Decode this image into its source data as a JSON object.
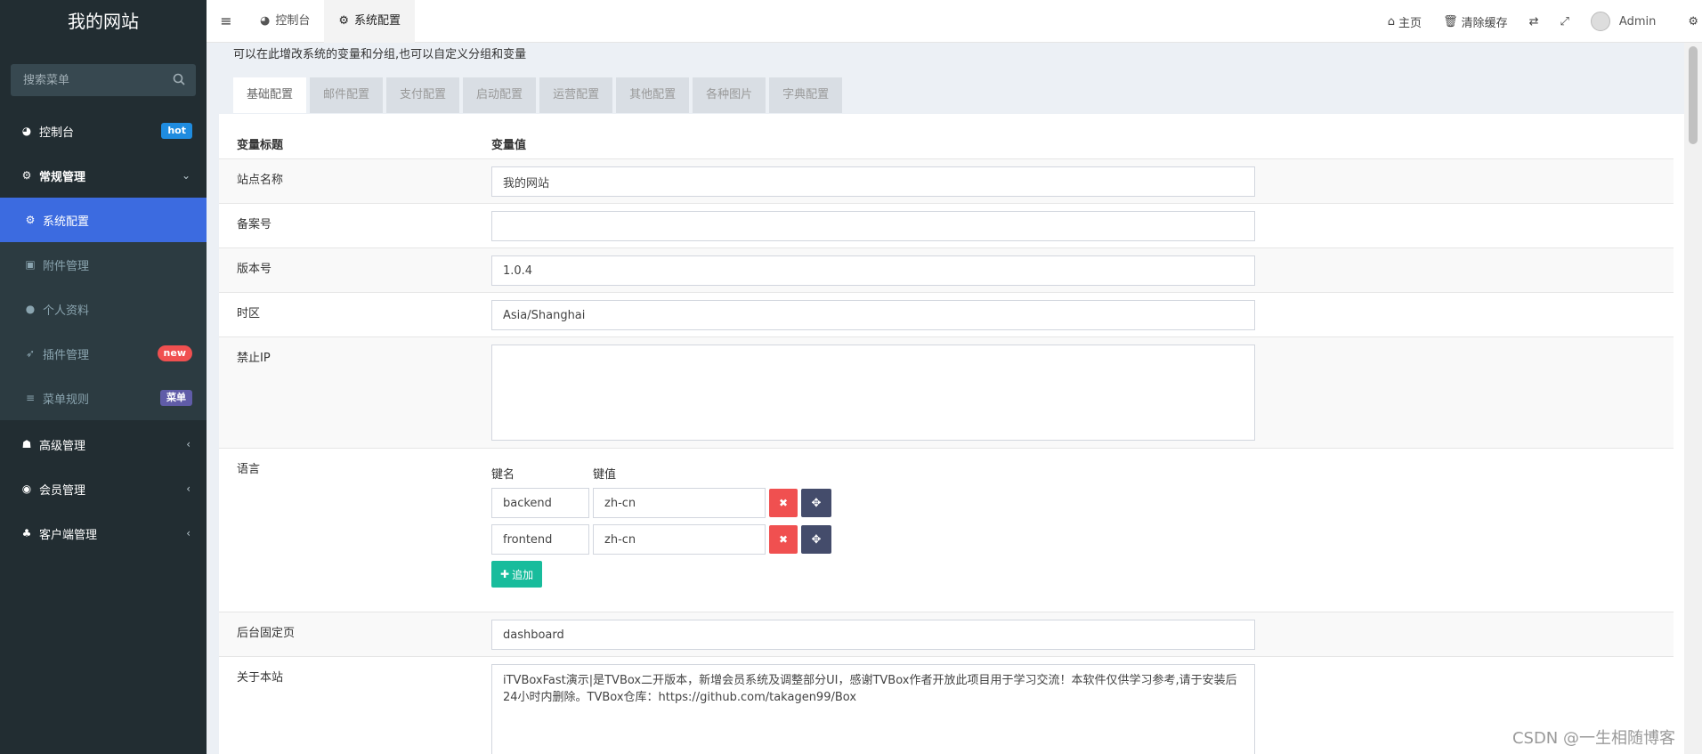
{
  "sidebar": {
    "logo": "我的网站",
    "search_placeholder": "搜索菜单",
    "items": [
      {
        "label": "控制台",
        "badge": "hot",
        "icon": "dashboard-icon"
      },
      {
        "label": "常规管理",
        "icon": "cogs-icon"
      },
      {
        "label": "系统配置",
        "icon": "gear-icon"
      },
      {
        "label": "附件管理",
        "icon": "image-icon"
      },
      {
        "label": "个人资料",
        "icon": "user-icon"
      },
      {
        "label": "插件管理",
        "badge": "new",
        "icon": "rocket-icon"
      },
      {
        "label": "菜单规则",
        "badge": "菜单",
        "icon": "list-icon"
      },
      {
        "label": "高级管理",
        "icon": "users-icon"
      },
      {
        "label": "会员管理",
        "icon": "user-circle-icon"
      },
      {
        "label": "客户端管理",
        "icon": "android-icon"
      }
    ]
  },
  "topbar": {
    "tabs": [
      {
        "label": "控制台",
        "icon": "dashboard-icon"
      },
      {
        "label": "系统配置",
        "icon": "gear-icon"
      }
    ],
    "right": {
      "home": "主页",
      "clear_cache": "清除缓存",
      "user": "Admin"
    }
  },
  "main": {
    "description": "可以在此增改系统的变量和分组,也可以自定义分组和变量",
    "config_tabs": [
      "基础配置",
      "邮件配置",
      "支付配置",
      "启动配置",
      "运营配置",
      "其他配置",
      "各种图片",
      "字典配置"
    ],
    "table_headers": {
      "title": "变量标题",
      "value": "变量值"
    },
    "fields": {
      "site_name": {
        "label": "站点名称",
        "value": "我的网站"
      },
      "beian": {
        "label": "备案号",
        "value": ""
      },
      "version": {
        "label": "版本号",
        "value": "1.0.4"
      },
      "timezone": {
        "label": "时区",
        "value": "Asia/Shanghai"
      },
      "forbidden_ip": {
        "label": "禁止IP",
        "value": ""
      },
      "language": {
        "label": "语言",
        "key_header": "键名",
        "value_header": "键值",
        "rows": [
          {
            "key": "backend",
            "value": "zh-cn"
          },
          {
            "key": "frontend",
            "value": "zh-cn"
          }
        ],
        "add_label": "追加"
      },
      "fixed_page": {
        "label": "后台固定页",
        "value": "dashboard"
      },
      "about": {
        "label": "关于本站",
        "value": "iTVBoxFast演示|是TVBox二开版本，新增会员系统及调整部分UI，感谢TVBox作者开放此项目用于学习交流！本软件仅供学习参考,请于安装后24小时内删除。TVBox仓库：https://github.com/takagen99/Box"
      }
    }
  },
  "watermark": "CSDN @一生相随博客"
}
